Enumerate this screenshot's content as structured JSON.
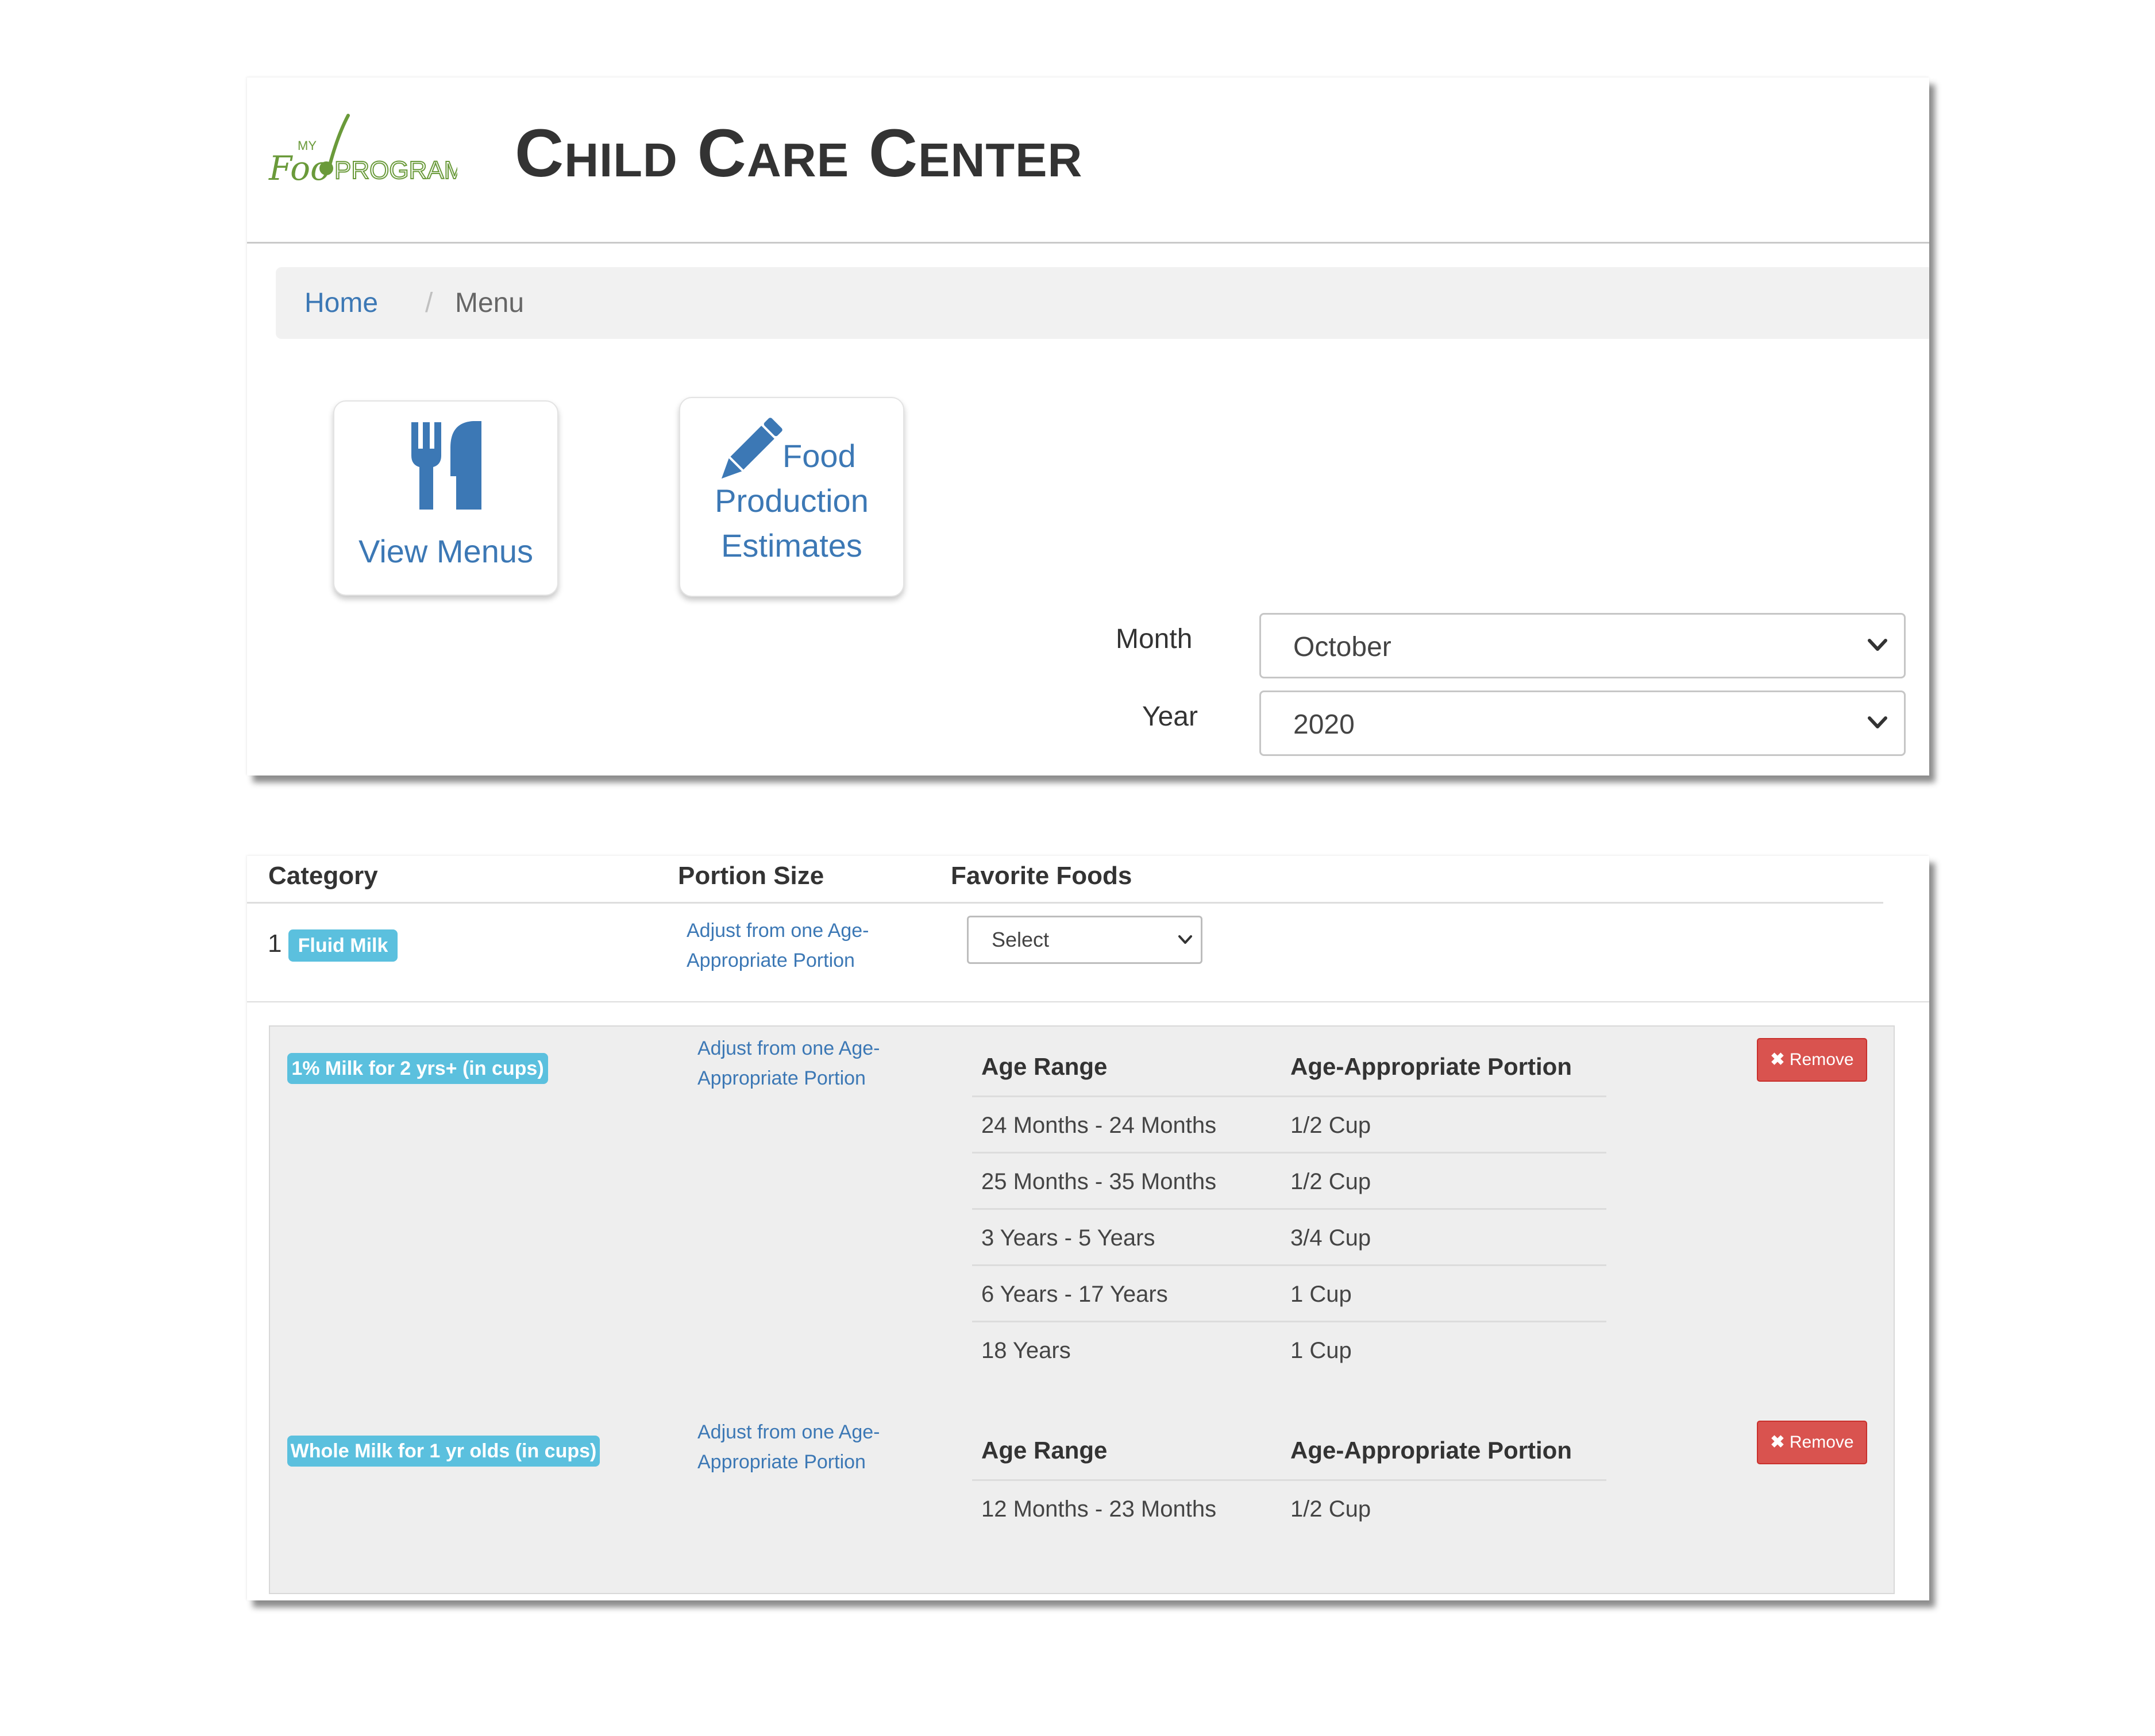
{
  "app": {
    "logo_text": "MyFoodProgram",
    "title": "Child Care Center"
  },
  "breadcrumb": {
    "home": "Home",
    "separator": "/",
    "current": "Menu"
  },
  "tiles": {
    "view_menus": {
      "label": "View Menus",
      "icon": "utensils-icon"
    },
    "food_production": {
      "label_line1": "Food",
      "label_line2": "Production",
      "label_line3": "Estimates",
      "icon": "pencil-icon"
    }
  },
  "filters": {
    "month": {
      "label": "Month",
      "value": "October"
    },
    "year": {
      "label": "Year",
      "value": "2020"
    }
  },
  "table": {
    "headers": {
      "category": "Category",
      "portion_size": "Portion Size",
      "favorite_foods": "Favorite Foods"
    },
    "row": {
      "number": "1",
      "category_badge": "Fluid Milk",
      "portion_line1": "Adjust from one Age-",
      "portion_line2": "Appropriate Portion",
      "favorite_select": "Select"
    }
  },
  "foods": [
    {
      "name": "1% Milk for 2 yrs+ (in cups)",
      "portion_line1": "Adjust from one Age-",
      "portion_line2": "Appropriate Portion",
      "col_age": "Age Range",
      "col_portion": "Age-Appropriate Portion",
      "rows": [
        {
          "age": "24 Months - 24 Months",
          "portion": "1/2 Cup"
        },
        {
          "age": "25 Months - 35 Months",
          "portion": "1/2 Cup"
        },
        {
          "age": "3 Years - 5 Years",
          "portion": "3/4 Cup"
        },
        {
          "age": "6 Years - 17 Years",
          "portion": "1 Cup"
        },
        {
          "age": "18 Years",
          "portion": "1 Cup"
        }
      ],
      "remove_label": "Remove"
    },
    {
      "name": "Whole Milk for 1 yr olds (in cups)",
      "portion_line1": "Adjust from one Age-",
      "portion_line2": "Appropriate Portion",
      "col_age": "Age Range",
      "col_portion": "Age-Appropriate Portion",
      "rows": [
        {
          "age": "12 Months - 23 Months",
          "portion": "1/2 Cup"
        }
      ],
      "remove_label": "Remove"
    }
  ],
  "colors": {
    "link_blue": "#3c78b5",
    "badge_blue": "#5bc0de",
    "danger_red": "#d9534f",
    "logo_green": "#6a9a3a"
  }
}
